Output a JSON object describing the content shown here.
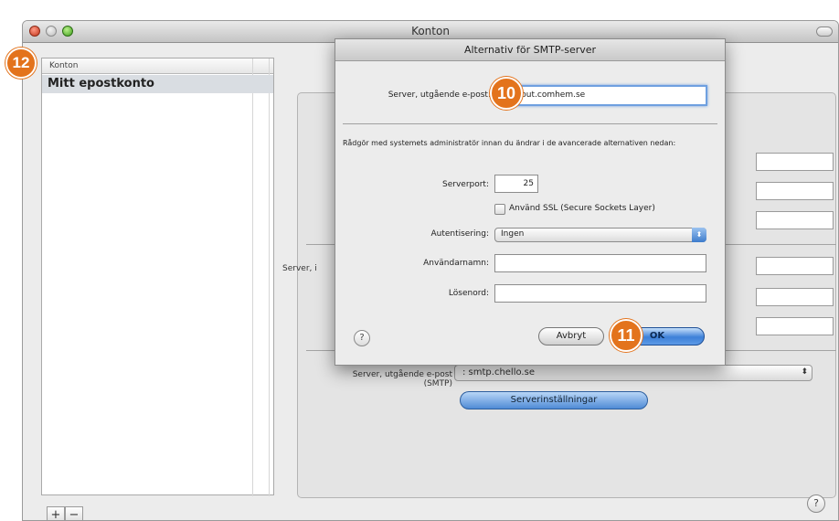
{
  "window": {
    "title": "Konton"
  },
  "sidebar": {
    "header": "Konton",
    "items": [
      {
        "label": "Mitt epostkonto"
      }
    ],
    "add_label": "+",
    "remove_label": "−"
  },
  "background": {
    "label_server_partial": "Server, i",
    "smtp_label_line1": "Server, utgående e-post",
    "smtp_label_line2": "(SMTP)",
    "smtp_value": ": smtp.chello.se",
    "settings_button": "Serverinställningar",
    "help_label": "?"
  },
  "sheet": {
    "title": "Alternativ för SMTP-server",
    "outgoing_label": "Server, utgående e-post:",
    "outgoing_value": "mailout.comhem.se",
    "note": "Rådgör med systemets administratör innan du ändrar i de avancerade alternativen nedan:",
    "port_label": "Serverport:",
    "port_value": "25",
    "ssl_label": "Använd SSL (Secure Sockets Layer)",
    "auth_label": "Autentisering:",
    "auth_value": "Ingen",
    "username_label": "Användarnamn:",
    "username_value": "",
    "password_label": "Lösenord:",
    "password_value": "",
    "help_label": "?",
    "cancel_label": "Avbryt",
    "ok_label": "OK"
  },
  "callouts": {
    "c10": "10",
    "c11": "11",
    "c12": "12"
  },
  "colors": {
    "callout": "#e3731c",
    "focus_ring": "#6fa0e0",
    "selection": "#d9dde2"
  }
}
